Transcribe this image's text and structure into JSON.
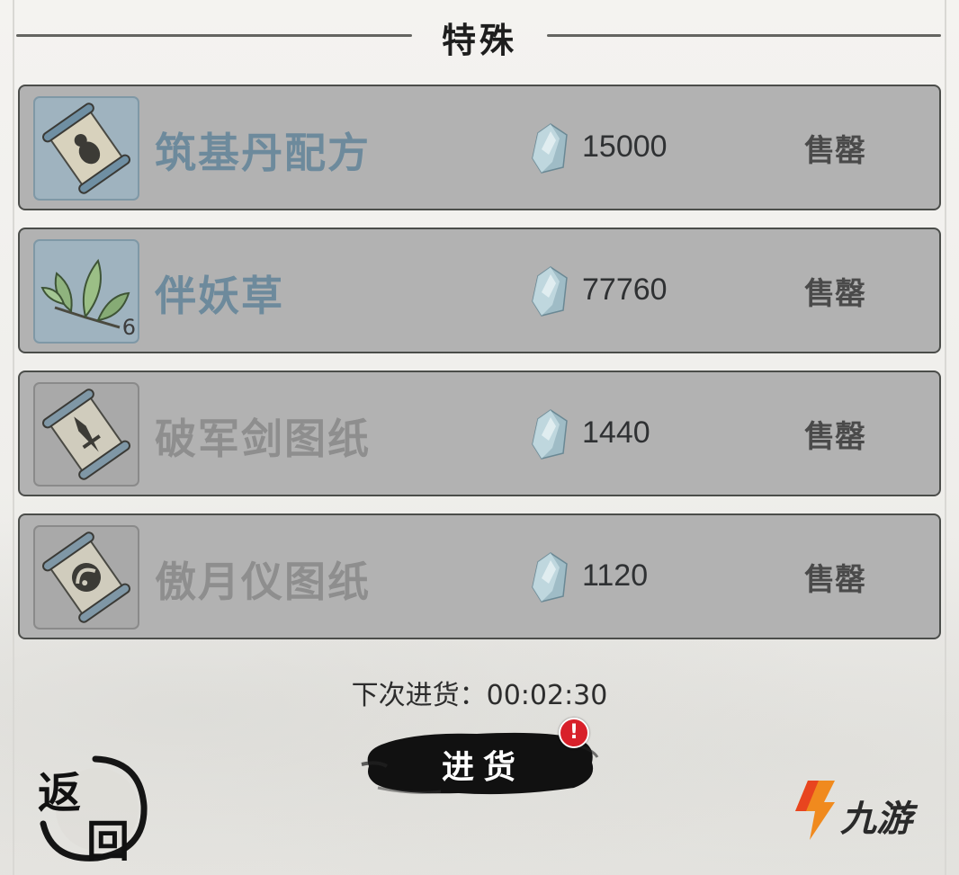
{
  "header": {
    "title": "特殊"
  },
  "items": [
    {
      "name": "筑基丹配方",
      "icon": "recipe-scroll-icon",
      "price": "15000",
      "status": "售罄",
      "name_color": "#6d8a9c",
      "highlight": true,
      "qty": ""
    },
    {
      "name": "伴妖草",
      "icon": "herb-leaf-icon",
      "price": "77760",
      "status": "售罄",
      "name_color": "#6d8a9c",
      "highlight": true,
      "qty": "6"
    },
    {
      "name": "破军剑图纸",
      "icon": "sword-blueprint-scroll-icon",
      "price": "1440",
      "status": "售罄",
      "name_color": "#8e8e8e",
      "highlight": false,
      "qty": ""
    },
    {
      "name": "傲月仪图纸",
      "icon": "artifact-blueprint-scroll-icon",
      "price": "1120",
      "status": "售罄",
      "name_color": "#8e8e8e",
      "highlight": false,
      "qty": ""
    }
  ],
  "timer": {
    "text": "下次进货：00:02:30"
  },
  "restock": {
    "label": "进货",
    "badge": "!"
  },
  "back": {
    "char1": "返",
    "char2": "回"
  },
  "watermark": {
    "text": "九游"
  }
}
